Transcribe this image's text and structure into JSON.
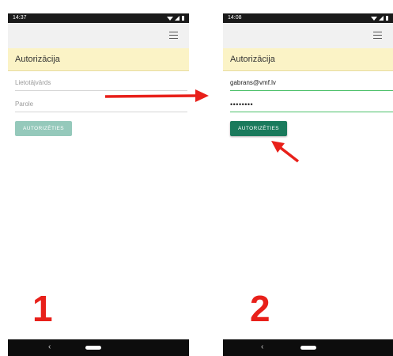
{
  "colors": {
    "section_header_bg": "#fbf3c6",
    "button_disabled": "#95c9bb",
    "button_active": "#1a7a5c",
    "input_focus_line": "#4cc06a",
    "annotation_red": "#e8201a"
  },
  "screens": [
    {
      "status_time": "14:37",
      "menu_icon": "hamburger-menu-icon",
      "section_title": "Autorizācija",
      "username_placeholder": "Lietotājvārds",
      "password_placeholder": "Parole",
      "button_label": "AUTORIZĒTIES",
      "nav_back": "‹"
    },
    {
      "status_time": "14:08",
      "menu_icon": "hamburger-menu-icon",
      "section_title": "Autorizācija",
      "username_value": "gabrans@vmf.lv",
      "password_value": "••••••••",
      "button_label": "AUTORIZĒTIES",
      "nav_back": "‹"
    }
  ],
  "annotations": {
    "step1": "1",
    "step2": "2"
  }
}
